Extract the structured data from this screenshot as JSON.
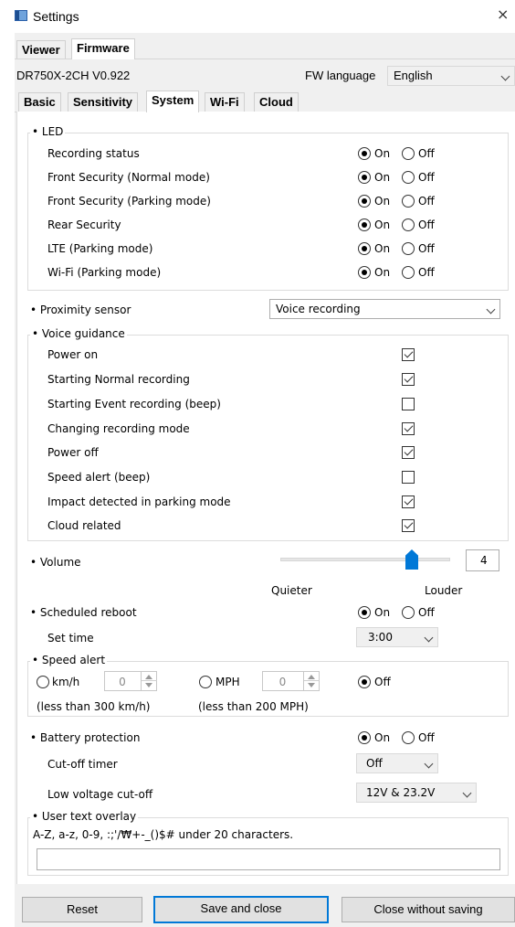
{
  "window": {
    "title": "Settings",
    "close_glyph": "×"
  },
  "top_tabs": [
    {
      "label": "Viewer"
    },
    {
      "label": "Firmware"
    }
  ],
  "device": {
    "model": "DR750X-2CH  V0.922",
    "fw_language_label": "FW language",
    "fw_language_value": "English"
  },
  "sub_tabs": [
    {
      "label": "Basic"
    },
    {
      "label": "Sensitivity"
    },
    {
      "label": "System"
    },
    {
      "label": "Wi-Fi"
    },
    {
      "label": "Cloud"
    }
  ],
  "radio_on": "On",
  "radio_off": "Off",
  "led": {
    "title": "• LED",
    "items": [
      {
        "label": "Recording status",
        "value": "On"
      },
      {
        "label": "Front Security (Normal mode)",
        "value": "On"
      },
      {
        "label": "Front Security (Parking mode)",
        "value": "On"
      },
      {
        "label": "Rear Security",
        "value": "On"
      },
      {
        "label": "LTE (Parking mode)",
        "value": "On"
      },
      {
        "label": "Wi-Fi (Parking mode)",
        "value": "On"
      }
    ]
  },
  "proximity": {
    "label": "• Proximity sensor",
    "value": "Voice recording"
  },
  "voice_guidance": {
    "title": "• Voice guidance",
    "items": [
      {
        "label": "Power on",
        "checked": true
      },
      {
        "label": "Starting Normal recording",
        "checked": true
      },
      {
        "label": "Starting Event recording (beep)",
        "checked": false
      },
      {
        "label": "Changing recording mode",
        "checked": true
      },
      {
        "label": "Power off",
        "checked": true
      },
      {
        "label": "Speed alert (beep)",
        "checked": false
      },
      {
        "label": "Impact detected in parking mode",
        "checked": true
      },
      {
        "label": "Cloud related",
        "checked": true
      }
    ]
  },
  "volume": {
    "label": "• Volume",
    "value": "4",
    "level_fraction": 0.78,
    "quieter": "Quieter",
    "louder": "Louder"
  },
  "scheduled_reboot": {
    "label": "• Scheduled reboot",
    "value": "On",
    "set_time_label": "Set time",
    "set_time_value": "3:00"
  },
  "speed_alert": {
    "title": "• Speed alert",
    "kmh_label": "km/h",
    "kmh_value": "0",
    "kmh_note": "(less than 300 km/h)",
    "mph_label": "MPH",
    "mph_value": "0",
    "mph_note": "(less than 200 MPH)",
    "off_label": "Off",
    "selected": "Off"
  },
  "battery": {
    "label": "• Battery protection",
    "value": "On",
    "cutoff_timer_label": "Cut-off timer",
    "cutoff_timer_value": "Off",
    "low_voltage_label": "Low voltage cut-off",
    "low_voltage_value": "12V & 23.2V"
  },
  "overlay": {
    "title": "• User text overlay",
    "hint": "A-Z, a-z, 0-9, :;'/₩+-_()$# under 20 characters.",
    "value": ""
  },
  "buttons": {
    "reset": "Reset",
    "save": "Save and close",
    "close": "Close without saving"
  }
}
